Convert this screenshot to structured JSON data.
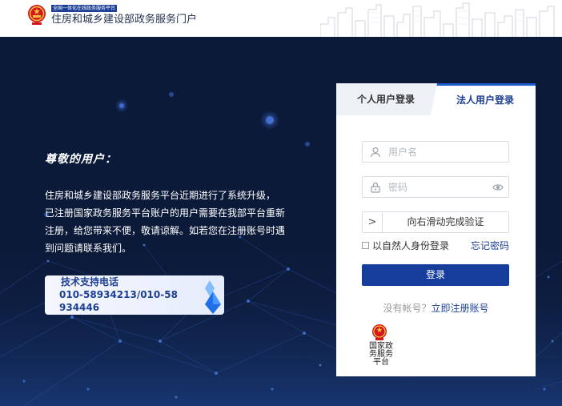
{
  "header": {
    "small_banner": "全国一体化在线政务服务平台",
    "title": "住房和城乡建设部政务服务门户",
    "emblem_icon": "national-emblem-icon",
    "skyline_icon": "city-skyline-icon"
  },
  "notice": {
    "greeting": "尊敬的用户：",
    "body": "住房和城乡建设部政务服务平台近期进行了系统升级，  已注册国家政务服务平台账户的用户需要在我部平台重新注册，给您带来不便，敬请谅解。如若您在注册账号时遇到问题请联系我们。"
  },
  "support": {
    "title": "技术支持电话",
    "phone": "010-58934213/010-58934446"
  },
  "login": {
    "tabs": [
      {
        "label": "个人用户登录",
        "active": false
      },
      {
        "label": "法人用户登录",
        "active": true
      }
    ],
    "username_placeholder": "用户名",
    "password_placeholder": "密码",
    "slider_handle": ">",
    "slider_text": "向右滑动完成验证",
    "natural_person_label": "以自然人身份登录",
    "forgot_password": "忘记密码",
    "login_button": "登录",
    "no_account": "没有帐号？",
    "register_link": "立即注册账号",
    "national_platform_text": "国家政务服务平台"
  },
  "colors": {
    "brand_blue": "#163c9c",
    "background": "#0c1a3a",
    "link": "#1d3f94"
  }
}
